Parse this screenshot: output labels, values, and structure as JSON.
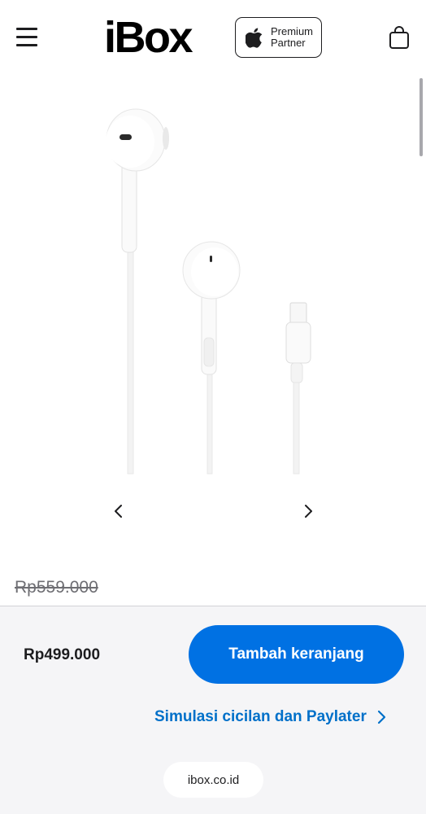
{
  "header": {
    "logo_text": "iBox",
    "badge_line1": "Premium",
    "badge_line2": "Partner"
  },
  "product": {
    "original_price": "Rp559.000",
    "price": "Rp499.000"
  },
  "actions": {
    "add_to_cart_label": "Tambah keranjang",
    "installment_link_label": "Simulasi cicilan dan Paylater"
  },
  "browser": {
    "url": "ibox.co.id"
  },
  "icons": {
    "menu": "hamburger-menu-icon",
    "brand": "apple-logo-icon",
    "cart": "shopping-bag-icon",
    "prev": "chevron-left-icon",
    "next": "chevron-right-icon",
    "link_arrow": "chevron-right-icon"
  },
  "colors": {
    "accent": "#0071e3",
    "link": "#0070c9",
    "bottom_bar_bg": "#f5f5f7"
  }
}
